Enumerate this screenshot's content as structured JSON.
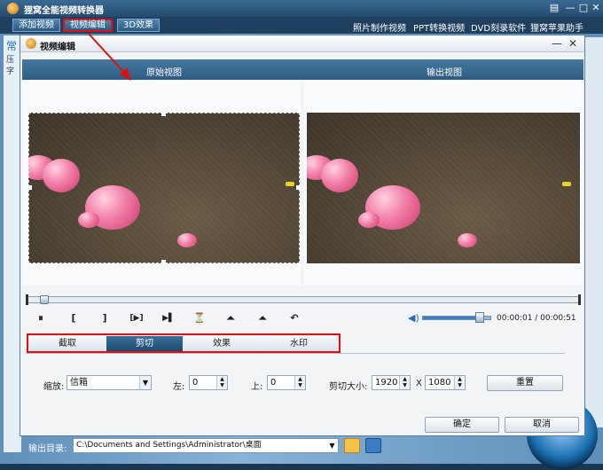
{
  "app": {
    "title": "狸窝全能视频转换器",
    "toolbar": {
      "add_video": "添加视频",
      "edit_video": "视频编辑",
      "effect_3d": "3D效果",
      "links": [
        "照片制作视频",
        "PPT转换视频",
        "DVD刻录软件",
        "狸窝苹果助手"
      ]
    },
    "side_labels": [
      "常",
      "压",
      "字"
    ]
  },
  "dialog": {
    "title": "视频编辑",
    "original_view": "原始视图",
    "output_view": "输出视图",
    "time_display": "00:00:01 / 00:00:51",
    "volume_percent": 85,
    "seek_percent": 2,
    "controls": {
      "play": "⏸",
      "mark_in": "[",
      "mark_out": "]",
      "clip": "[▶]",
      "next": "▶▌",
      "trim": "⏳",
      "rotate_left": "⏶",
      "rotate_right": "⏶",
      "undo": "↶"
    },
    "tabs": [
      "截取",
      "剪切",
      "效果",
      "水印"
    ],
    "active_tab": "剪切",
    "crop": {
      "zoom_label": "缩放:",
      "zoom_value": "信箱",
      "left_label": "左:",
      "left_value": "0",
      "top_label": "上:",
      "top_value": "0",
      "size_label": "剪切大小:",
      "width": "1920",
      "x_label": "X",
      "height": "1080",
      "reset": "重置"
    },
    "ok": "确定",
    "cancel": "取消"
  },
  "output": {
    "label": "输出目录:",
    "path": "C:\\Documents and Settings\\Administrator\\桌面"
  }
}
